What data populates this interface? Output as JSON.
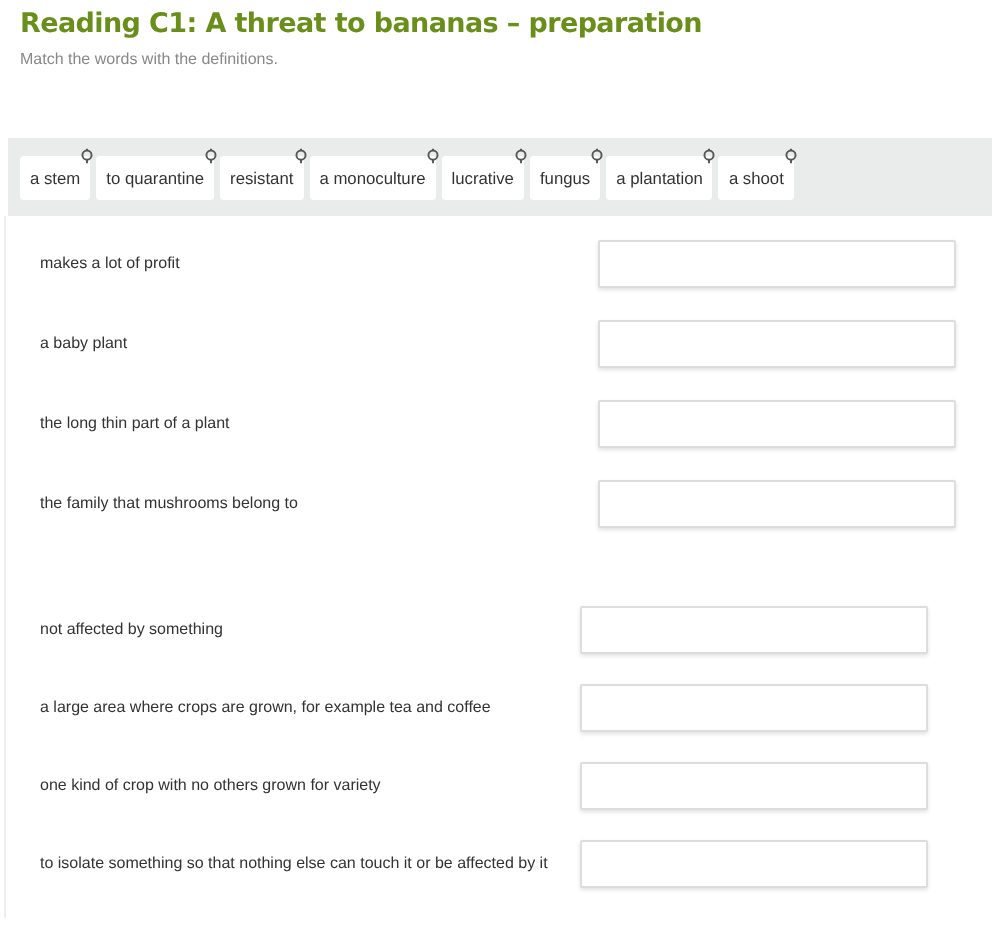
{
  "title": "Reading C1: A threat to bananas – preparation",
  "instruction": "Match the words with the definitions.",
  "word_bank": [
    "a stem",
    "to quarantine",
    "resistant",
    "a monoculture",
    "lucrative",
    "fungus",
    "a plantation",
    "a shoot"
  ],
  "groups": [
    {
      "definitions": [
        "makes a lot of profit",
        "a baby plant",
        "the long thin part of a plant",
        "the family that mushrooms belong to"
      ]
    },
    {
      "definitions": [
        "not affected by something",
        "a large area where crops are grown, for example tea and coffee",
        "one kind of crop with no others grown for variety",
        "to isolate something so that nothing else can touch it or be affected by it"
      ]
    }
  ]
}
